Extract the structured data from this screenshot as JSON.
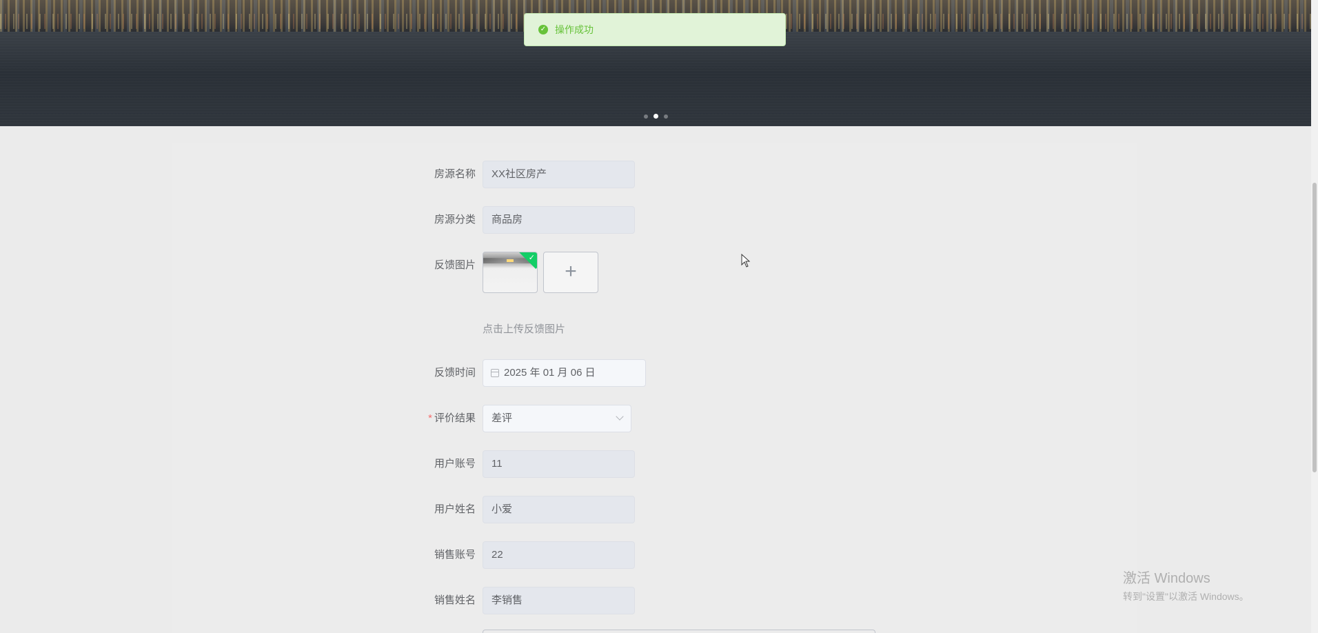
{
  "toast": {
    "text": "操作成功",
    "icon": "check-circle-icon",
    "color": "#67c23a"
  },
  "banner": {
    "slides": 3,
    "active_slide": 2
  },
  "form": {
    "house_name": {
      "label": "房源名称",
      "value": "XX社区房产"
    },
    "house_category": {
      "label": "房源分类",
      "value": "商品房"
    },
    "feedback_image": {
      "label": "反馈图片",
      "hint": "点击上传反馈图片",
      "upload_icon": "+"
    },
    "feedback_time": {
      "label": "反馈时间",
      "value": "2025 年 01 月 06 日"
    },
    "evaluation": {
      "label": "评价结果",
      "required_mark": "*",
      "value": "差评"
    },
    "user_account": {
      "label": "用户账号",
      "value": "11"
    },
    "user_name": {
      "label": "用户姓名",
      "value": "小爱"
    },
    "sales_account": {
      "label": "销售账号",
      "value": "22"
    },
    "sales_name": {
      "label": "销售姓名",
      "value": "李销售"
    }
  },
  "watermark": {
    "title": "激活 Windows",
    "subtitle": "转到\"设置\"以激活 Windows。"
  }
}
